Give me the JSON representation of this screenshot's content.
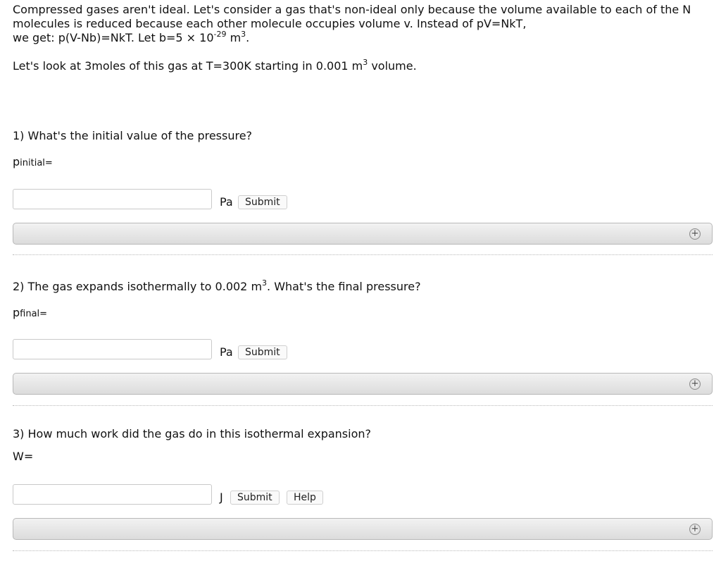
{
  "intro": {
    "line1": "Compressed gases aren't ideal. Let's consider a gas that's non-ideal only because the volume available to each of the N molecules is reduced because each other molecule occupies volume v. Instead of pV=NkT,",
    "line2_prefix": "we get: p(V-Nb)=NkT. Let b=5 × 10",
    "line2_exp": "-29",
    "line2_unit": " m",
    "line2_unit_exp": "3",
    "line2_end": ".",
    "p2_prefix": "Let's look at 3moles of this gas at T=300K starting in 0.001 m",
    "p2_exp": "3",
    "p2_suffix": " volume."
  },
  "q1": {
    "question": "1) What's the initial value of the pressure?",
    "var": "p",
    "var_sub": "initial",
    "eq": "=",
    "unit": "Pa",
    "submit": "Submit",
    "value": ""
  },
  "q2": {
    "question_prefix": "2) The gas expands isothermally to 0.002 m",
    "question_exp": "3",
    "question_suffix": ". What's the final pressure?",
    "var": "p",
    "var_sub": "final",
    "eq": "=",
    "unit": "Pa",
    "submit": "Submit",
    "value": ""
  },
  "q3": {
    "question": "3) How much work did the gas do in this isothermal expansion?",
    "var": "W=",
    "unit": "J",
    "submit": "Submit",
    "help": "Help",
    "value": ""
  },
  "icons": {
    "expand": "plus-circle-icon"
  },
  "expand_symbol": "+"
}
